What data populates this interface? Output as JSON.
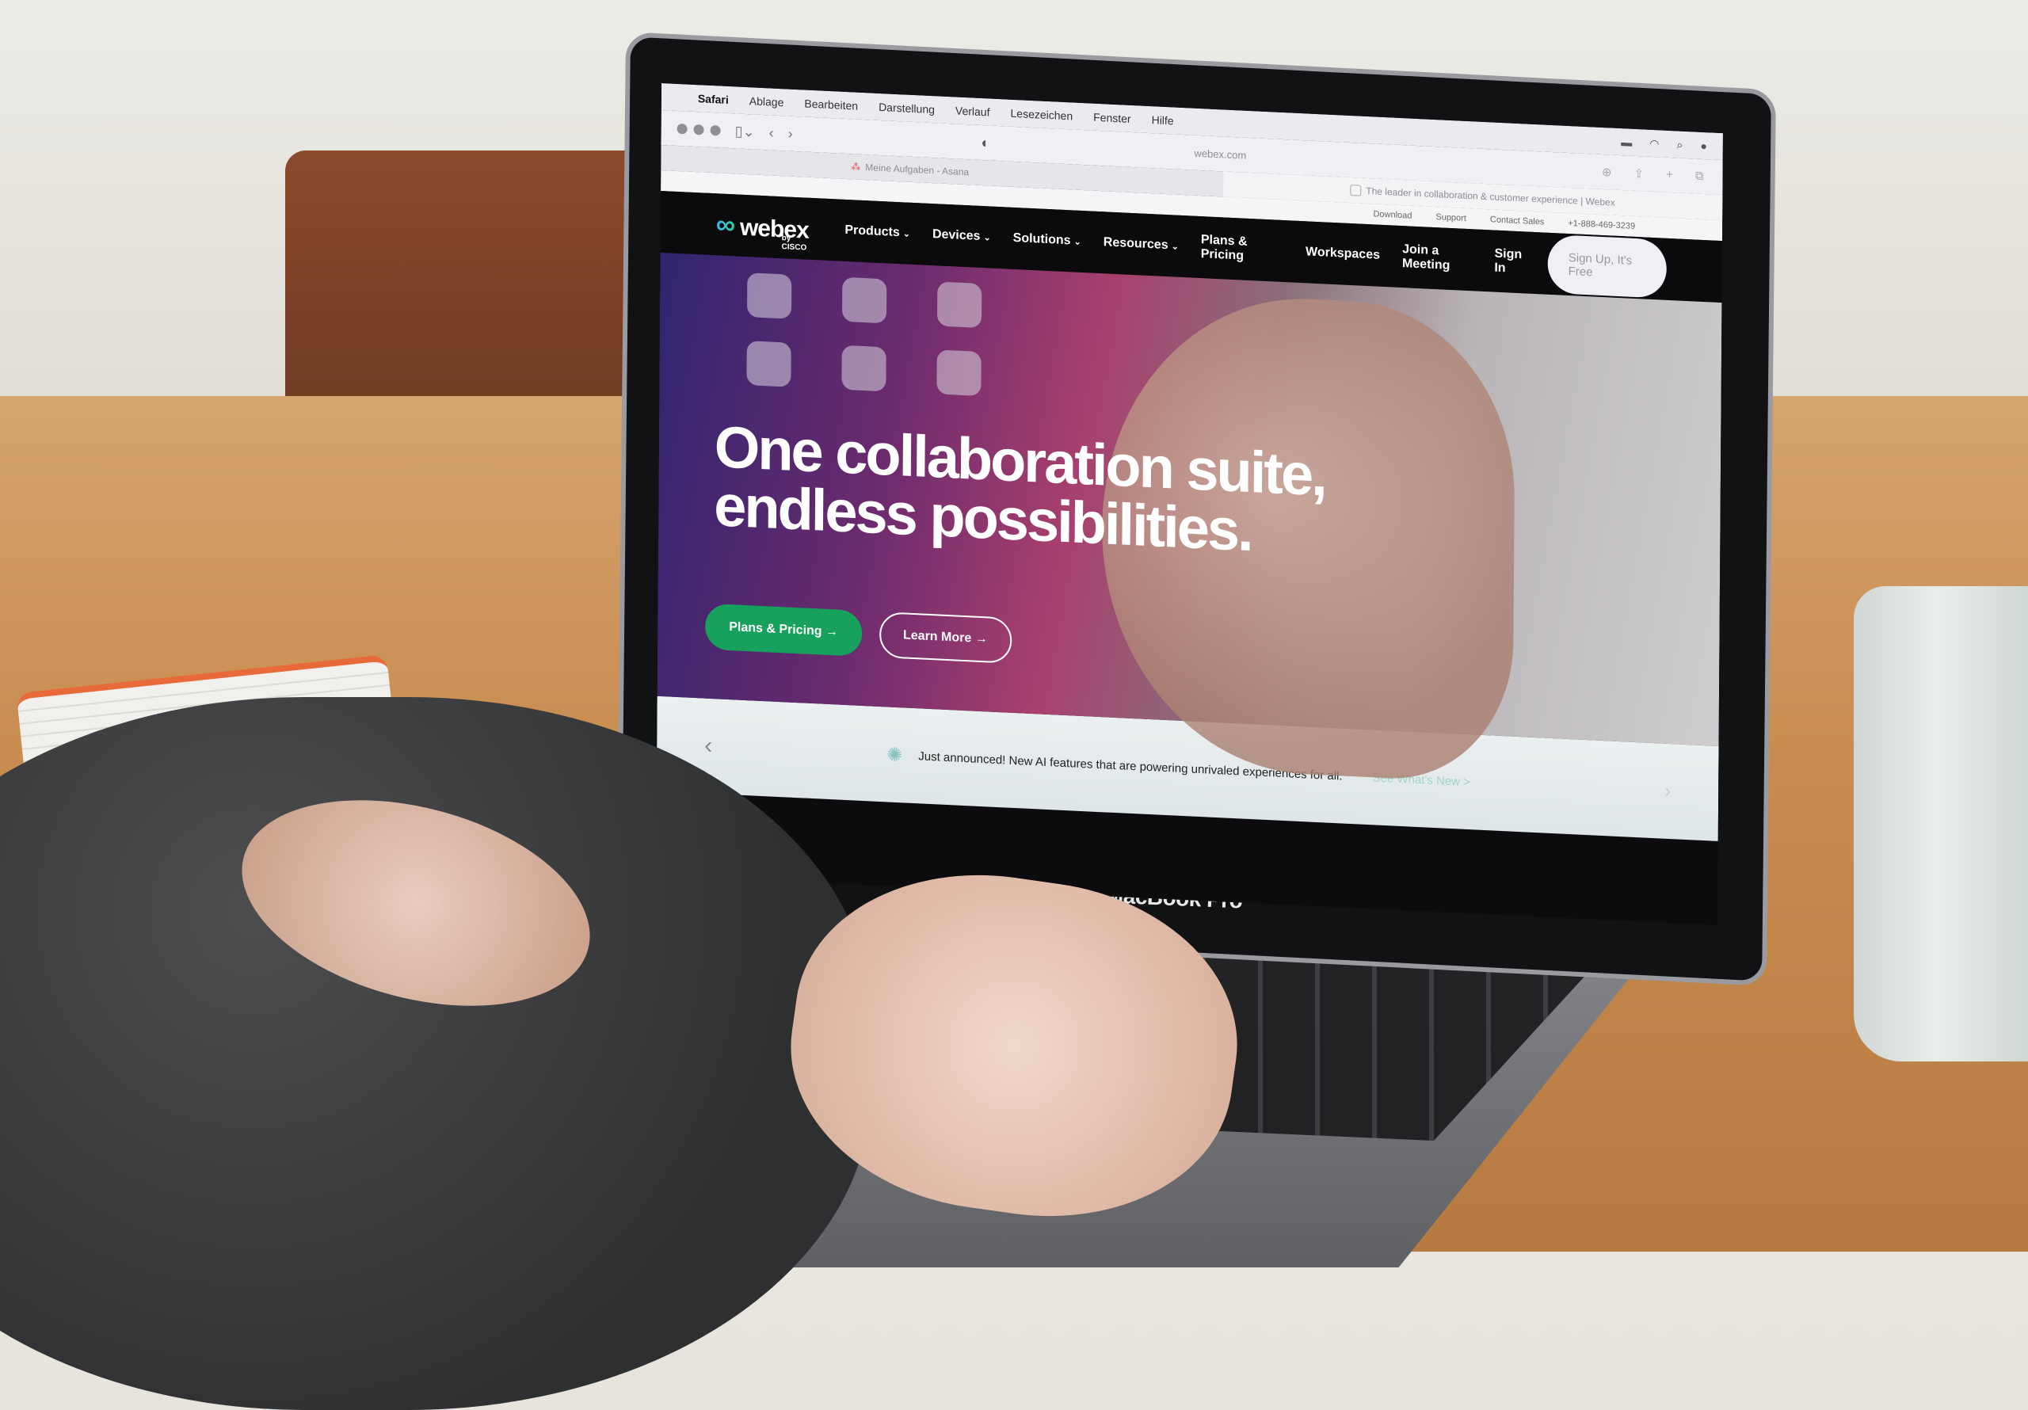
{
  "macos_menubar": {
    "apple_icon": "apple-logo-icon",
    "app_name": "Safari",
    "items": [
      "Ablage",
      "Bearbeiten",
      "Darstellung",
      "Verlauf",
      "Lesezeichen",
      "Fenster",
      "Hilfe"
    ],
    "status_icons": [
      "app-icon",
      "record-icon",
      "bluetooth-icon",
      "clock-icon",
      "x-icon",
      "battery-icon",
      "wifi-icon",
      "search-icon",
      "user-icon",
      "siri-icon"
    ]
  },
  "browser": {
    "address": "webex.com",
    "tabs": [
      {
        "title": "Meine Aufgaben - Asana",
        "icon": "asana-icon"
      },
      {
        "title": "The leader in collaboration & customer experience | Webex",
        "icon": "webex-favicon-icon"
      }
    ]
  },
  "site": {
    "utility_links": [
      "Download",
      "Support",
      "Contact Sales",
      "+1-888-469-3239"
    ],
    "logo": {
      "name": "webex",
      "byline": "by CISCO"
    },
    "nav": [
      {
        "label": "Products",
        "dropdown": true
      },
      {
        "label": "Devices",
        "dropdown": true
      },
      {
        "label": "Solutions",
        "dropdown": true
      },
      {
        "label": "Resources",
        "dropdown": true
      },
      {
        "label": "Plans & Pricing",
        "dropdown": false
      },
      {
        "label": "Workspaces",
        "dropdown": false
      }
    ],
    "nav_right": {
      "join": "Join a Meeting",
      "signin": "Sign In",
      "signup": "Sign Up, It's Free"
    },
    "hero": {
      "title_line1": "One collaboration suite,",
      "title_line2": "endless possibilities.",
      "primary_button": "Plans & Pricing →",
      "secondary_button": "Learn More →"
    },
    "banner": {
      "text": "Just announced! New AI features that are powering unrivaled experiences for all.",
      "link": "See What's New >"
    },
    "colors": {
      "primary_green": "#17a15c",
      "nav_bg": "#0b0b0d"
    }
  },
  "hardware": {
    "laptop_label": "MacBook Pro"
  }
}
